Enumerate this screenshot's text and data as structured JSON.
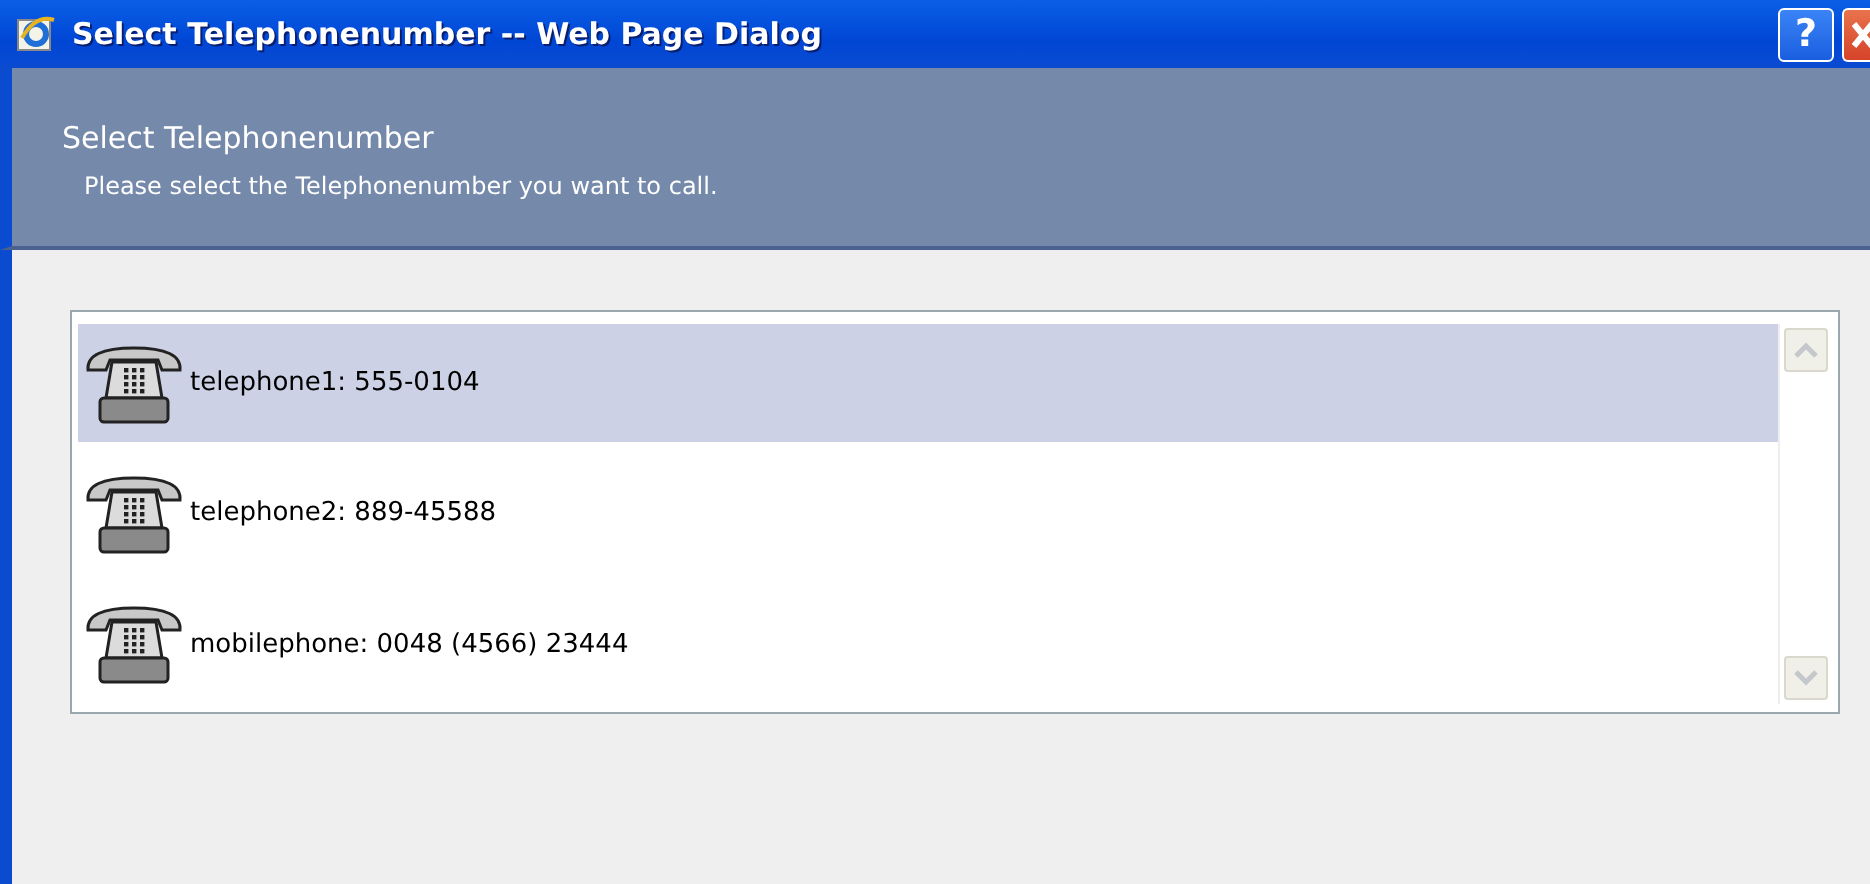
{
  "window": {
    "title": "Select Telephonenumber -- Web Page Dialog",
    "help_button": "?"
  },
  "header": {
    "title": "Select Telephonenumber",
    "subtitle": "Please select the Telephonenumber you want to call."
  },
  "phones": [
    {
      "label": "telephone1: 555-0104",
      "selected": true
    },
    {
      "label": "telephone2: 889-45588",
      "selected": false
    },
    {
      "label": "mobilephone: 0048 (4566) 23444",
      "selected": false
    }
  ]
}
